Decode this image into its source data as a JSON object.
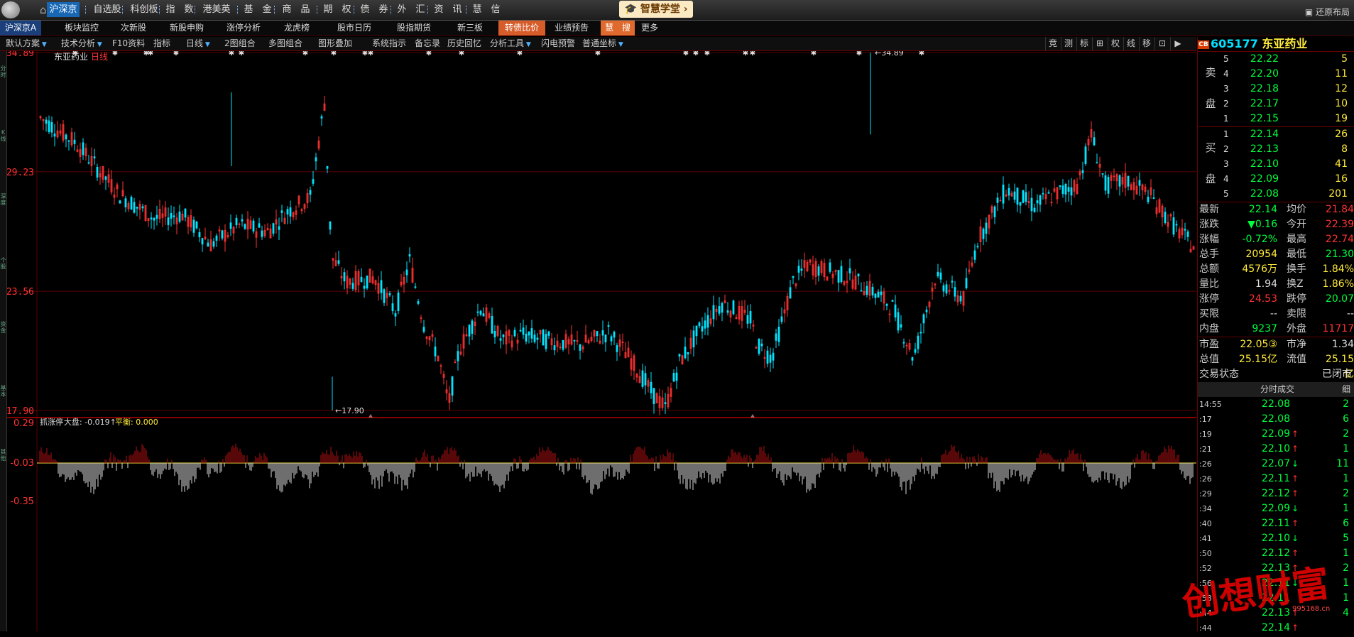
{
  "top_menu": [
    "沪深京",
    "自选股",
    "科创板",
    "指　数",
    "港美英",
    "基　金",
    "商　品",
    "期　权",
    "债　券",
    "外　汇",
    "资　讯",
    "慧　信"
  ],
  "academy": "智慧学堂",
  "restore_layout": "还原布局",
  "row2": [
    "沪深京A",
    "板块监控",
    "次新股",
    "新股申购",
    "涨停分析",
    "龙虎榜",
    "股市日历",
    "股指期货",
    "新三板",
    "转债比价",
    "业绩预告",
    "慧　搜",
    "更多"
  ],
  "row3": [
    "默认方案",
    "技术分析",
    "F10资料",
    "指标",
    "日线",
    "2图组合",
    "多图组合",
    "图形叠加",
    "系统指示",
    "备忘录",
    "历史回忆",
    "分析工具",
    "闪电预警",
    "普通坐标"
  ],
  "row3_right": [
    "竞",
    "测",
    "标",
    "⊞",
    "权",
    "线",
    "移",
    "⊡",
    "▶"
  ],
  "chart": {
    "title": "东亚药业",
    "period": "日线",
    "y_labels": [
      "34.89",
      "29.23",
      "23.56",
      "17.90"
    ],
    "high_marker": "34.89",
    "low_marker": "17.90",
    "ind_title": "抓涨停",
    "ind_market": "大盘: -0.019↑",
    "ind_balance": "平衡: 0.000",
    "ind_labels": [
      "0.29",
      "-0.03",
      "-0.35"
    ]
  },
  "quote": {
    "code": "605177",
    "name": "东亚药业",
    "cb": "CB",
    "sell_label": [
      "卖",
      "盘"
    ],
    "buy_label": [
      "买",
      "盘"
    ],
    "asks": [
      {
        "lvl": "5",
        "price": "22.22",
        "vol": "5"
      },
      {
        "lvl": "4",
        "price": "22.20",
        "vol": "11"
      },
      {
        "lvl": "3",
        "price": "22.18",
        "vol": "12"
      },
      {
        "lvl": "2",
        "price": "22.17",
        "vol": "10"
      },
      {
        "lvl": "1",
        "price": "22.15",
        "vol": "19"
      }
    ],
    "bids": [
      {
        "lvl": "1",
        "price": "22.14",
        "vol": "26"
      },
      {
        "lvl": "2",
        "price": "22.13",
        "vol": "8"
      },
      {
        "lvl": "3",
        "price": "22.10",
        "vol": "41"
      },
      {
        "lvl": "4",
        "price": "22.09",
        "vol": "16"
      },
      {
        "lvl": "5",
        "price": "22.08",
        "vol": "201"
      }
    ],
    "stats": [
      [
        "最新",
        "22.14",
        "g",
        "均价",
        "21.84",
        "r"
      ],
      [
        "涨跌",
        "▼0.16",
        "g",
        "今开",
        "22.39",
        "r"
      ],
      [
        "涨幅",
        "-0.72%",
        "g",
        "最高",
        "22.74",
        "r"
      ],
      [
        "总手",
        "20954",
        "y",
        "最低",
        "21.30",
        "g"
      ],
      [
        "总额",
        "4576万",
        "y",
        "换手",
        "1.84%",
        "y"
      ],
      [
        "量比",
        "1.94",
        "w",
        "换Z",
        "1.86%",
        "y"
      ],
      [
        "涨停",
        "24.53",
        "r",
        "跌停",
        "20.07",
        "g"
      ],
      [
        "买限",
        "--",
        "w",
        "卖限",
        "--",
        "w"
      ],
      [
        "内盘",
        "9237",
        "g",
        "外盘",
        "11717",
        "r"
      ],
      [
        "市盈",
        "22.05③",
        "y",
        "市净",
        "1.34",
        "w"
      ],
      [
        "总值",
        "25.15亿",
        "y",
        "流值",
        "25.15亿",
        "y"
      ]
    ],
    "status_label": "交易状态",
    "status_value": "已闭市",
    "ticks_header": "分时成交",
    "ticks_detail": "细",
    "ticks": [
      {
        "t": "14:55",
        "p": "22.08",
        "a": "",
        "v": "2"
      },
      {
        "t": ":17",
        "p": "22.08",
        "a": "",
        "v": "6"
      },
      {
        "t": ":19",
        "p": "22.09",
        "a": "↑",
        "v": "2"
      },
      {
        "t": ":21",
        "p": "22.10",
        "a": "↑",
        "v": "1"
      },
      {
        "t": ":26",
        "p": "22.07",
        "a": "↓",
        "v": "11"
      },
      {
        "t": ":26",
        "p": "22.11",
        "a": "↑",
        "v": "1"
      },
      {
        "t": ":29",
        "p": "22.12",
        "a": "↑",
        "v": "2"
      },
      {
        "t": ":34",
        "p": "22.09",
        "a": "↓",
        "v": "1"
      },
      {
        "t": ":40",
        "p": "22.11",
        "a": "↑",
        "v": "6"
      },
      {
        "t": ":41",
        "p": "22.10",
        "a": "↓",
        "v": "5"
      },
      {
        "t": ":50",
        "p": "22.12",
        "a": "↑",
        "v": "1"
      },
      {
        "t": ":52",
        "p": "22.13",
        "a": "↑",
        "v": "2"
      },
      {
        "t": ":56",
        "p": "22.11",
        "a": "↓",
        "v": "1"
      },
      {
        "t": ":58",
        "p": "22.11",
        "a": "",
        "v": "1"
      },
      {
        "t": ":44",
        "p": "22.13",
        "a": "↑",
        "v": "4"
      },
      {
        "t": ":44",
        "p": "22.14",
        "a": "↑",
        "v": ""
      }
    ]
  },
  "watermark": "创想财富",
  "watermark_url": "995168.cn",
  "colors": {
    "up": "#ff3333",
    "down": "#00e5ff",
    "grid": "#5a0000",
    "accent": "#1767b5"
  }
}
